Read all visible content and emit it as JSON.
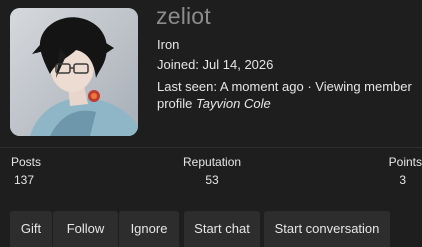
{
  "profile": {
    "username": "zeliot",
    "user_title": "Iron",
    "joined": "Joined: Jul 14, 2026",
    "last_seen_prefix": "Last seen: A moment ago · Viewing member profile",
    "last_seen_member": "Tayvion Cole"
  },
  "stats": {
    "posts": {
      "label": "Posts",
      "value": "137"
    },
    "reputation": {
      "label": "Reputation",
      "value": "53"
    },
    "points": {
      "label": "Points",
      "value": "3"
    }
  },
  "actions": {
    "gift": "Gift",
    "follow": "Follow",
    "ignore": "Ignore",
    "start_chat": "Start chat",
    "start_conversation": "Start conversation"
  },
  "colors": {
    "background": "#1e1e1e",
    "button_bg": "#2d2d2d",
    "username": "#8b8b8b"
  }
}
